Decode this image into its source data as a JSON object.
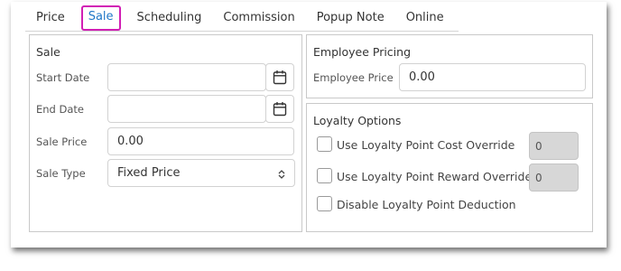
{
  "tabs": [
    {
      "label": "Price"
    },
    {
      "label": "Sale",
      "active": true
    },
    {
      "label": "Scheduling"
    },
    {
      "label": "Commission"
    },
    {
      "label": "Popup Note"
    },
    {
      "label": "Online"
    }
  ],
  "sale": {
    "title": "Sale",
    "start_date": {
      "label": "Start Date",
      "value": "",
      "icon": "calendar-icon"
    },
    "end_date": {
      "label": "End Date",
      "value": "",
      "icon": "calendar-icon"
    },
    "sale_price": {
      "label": "Sale Price",
      "value": "0.00"
    },
    "sale_type": {
      "label": "Sale Type",
      "value": "Fixed Price",
      "icon": "up-down-chevron-icon"
    }
  },
  "employee_pricing": {
    "title": "Employee Pricing",
    "employee_price": {
      "label": "Employee Price",
      "value": "0.00"
    }
  },
  "loyalty": {
    "title": "Loyalty Options",
    "cost_override": {
      "label": "Use Loyalty Point Cost Override",
      "value": "0",
      "checked": false
    },
    "reward_override": {
      "label": "Use Loyalty Point Reward Override",
      "value": "0",
      "checked": false
    },
    "disable_deduction": {
      "label": "Disable Loyalty Point Deduction",
      "checked": false
    }
  },
  "colors": {
    "active_tab_text": "#2178c8",
    "active_tab_highlight": "#d11fb4"
  }
}
